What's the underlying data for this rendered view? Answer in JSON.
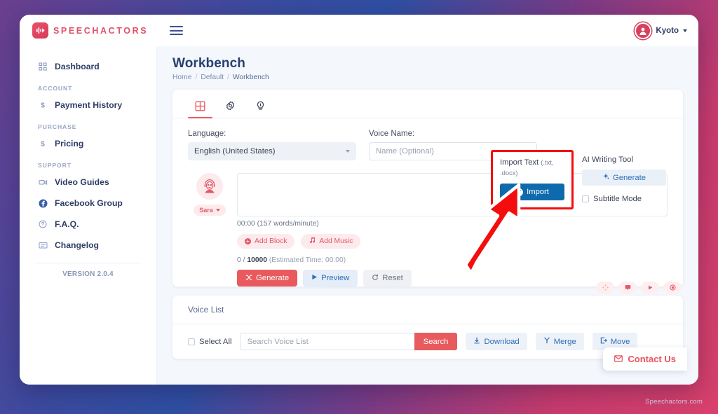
{
  "brand": {
    "name": "SPEECHACTORS",
    "logo_icon": "speech-wave-play-icon"
  },
  "topbar": {
    "menu_icon": "hamburger-menu-icon",
    "user_name": "Kyoto",
    "avatar_icon": "user-avatar-icon",
    "caret_icon": "chevron-down-icon"
  },
  "sidebar": {
    "items": [
      {
        "label": "Dashboard",
        "icon": "grid-dashboard-icon"
      }
    ],
    "groups": [
      {
        "title": "ACCOUNT",
        "items": [
          {
            "label": "Payment History",
            "icon": "dollar-icon"
          }
        ]
      },
      {
        "title": "PURCHASE",
        "items": [
          {
            "label": "Pricing",
            "icon": "dollar-icon"
          }
        ]
      },
      {
        "title": "SUPPORT",
        "items": [
          {
            "label": "Video Guides",
            "icon": "video-camera-icon"
          },
          {
            "label": "Facebook Group",
            "icon": "facebook-icon"
          },
          {
            "label": "F.A.Q.",
            "icon": "question-circle-icon"
          },
          {
            "label": "Changelog",
            "icon": "list-card-icon"
          }
        ]
      }
    ],
    "version": "VERSION 2.0.4"
  },
  "page": {
    "title": "Workbench",
    "breadcrumb": [
      "Home",
      "Default",
      "Workbench"
    ],
    "breadcrumb_sep": "/"
  },
  "tabs": [
    {
      "name": "workbench-tab",
      "icon": "grid-icon",
      "active": true
    },
    {
      "name": "settings-tab",
      "icon": "gear-icon",
      "active": false
    },
    {
      "name": "ideas-tab",
      "icon": "lightbulb-icon",
      "active": false
    }
  ],
  "form": {
    "language_label": "Language:",
    "language_value": "English (United States)",
    "voice_name_label": "Voice Name:",
    "voice_name_placeholder": "Name (Optional)"
  },
  "import": {
    "title": "Import Text",
    "extensions": "(.txt, .docx)",
    "button_label": "Import",
    "button_icon": "plus-circle-icon",
    "highlight_color": "#f40d0d",
    "button_color": "#0e6aac"
  },
  "ai_tool": {
    "title": "AI Writing Tool",
    "button_label": "Generate",
    "button_icon": "sparkle-icon",
    "subtitle_mode_label": "Subtitle Mode",
    "subtitle_mode_checked": false
  },
  "editor": {
    "speaker_name": "Sara",
    "speaker_avatar_icon": "female-character-avatar-icon",
    "text_value": "",
    "meta": "00:00 (157 words/minute)",
    "add_block_label": "Add Block",
    "add_music_label": "Add Music",
    "add_music_icon": "music-note-icon",
    "counter_current": "0",
    "counter_sep": "/",
    "counter_max": "10000",
    "counter_estimate": "(Estimated Time: 00:00)",
    "buttons": [
      {
        "label": "Generate",
        "icon": "shuffle-icon"
      },
      {
        "label": "Preview",
        "icon": "play-icon"
      },
      {
        "label": "Reset",
        "icon": "refresh-icon"
      }
    ],
    "float_tools": [
      {
        "name": "move-tool",
        "icon": "move-arrows-icon"
      },
      {
        "name": "comment-tool",
        "icon": "comment-icon"
      },
      {
        "name": "play-tool",
        "icon": "play-icon"
      },
      {
        "name": "settings-tool",
        "icon": "target-icon"
      }
    ]
  },
  "voice_list": {
    "title": "Voice List",
    "select_all_label": "Select All",
    "search_placeholder": "Search Voice List",
    "search_button": "Search",
    "actions": [
      {
        "label": "Download",
        "icon": "download-icon"
      },
      {
        "label": "Merge",
        "icon": "merge-icon"
      },
      {
        "label": "Move",
        "icon": "move-out-icon"
      }
    ]
  },
  "contact": {
    "label": "Contact Us",
    "icon": "envelope-icon"
  },
  "watermark": "Speechactors.com",
  "annotation": {
    "type": "red-arrow",
    "color": "#f40d0d",
    "points_to": "import-button"
  }
}
